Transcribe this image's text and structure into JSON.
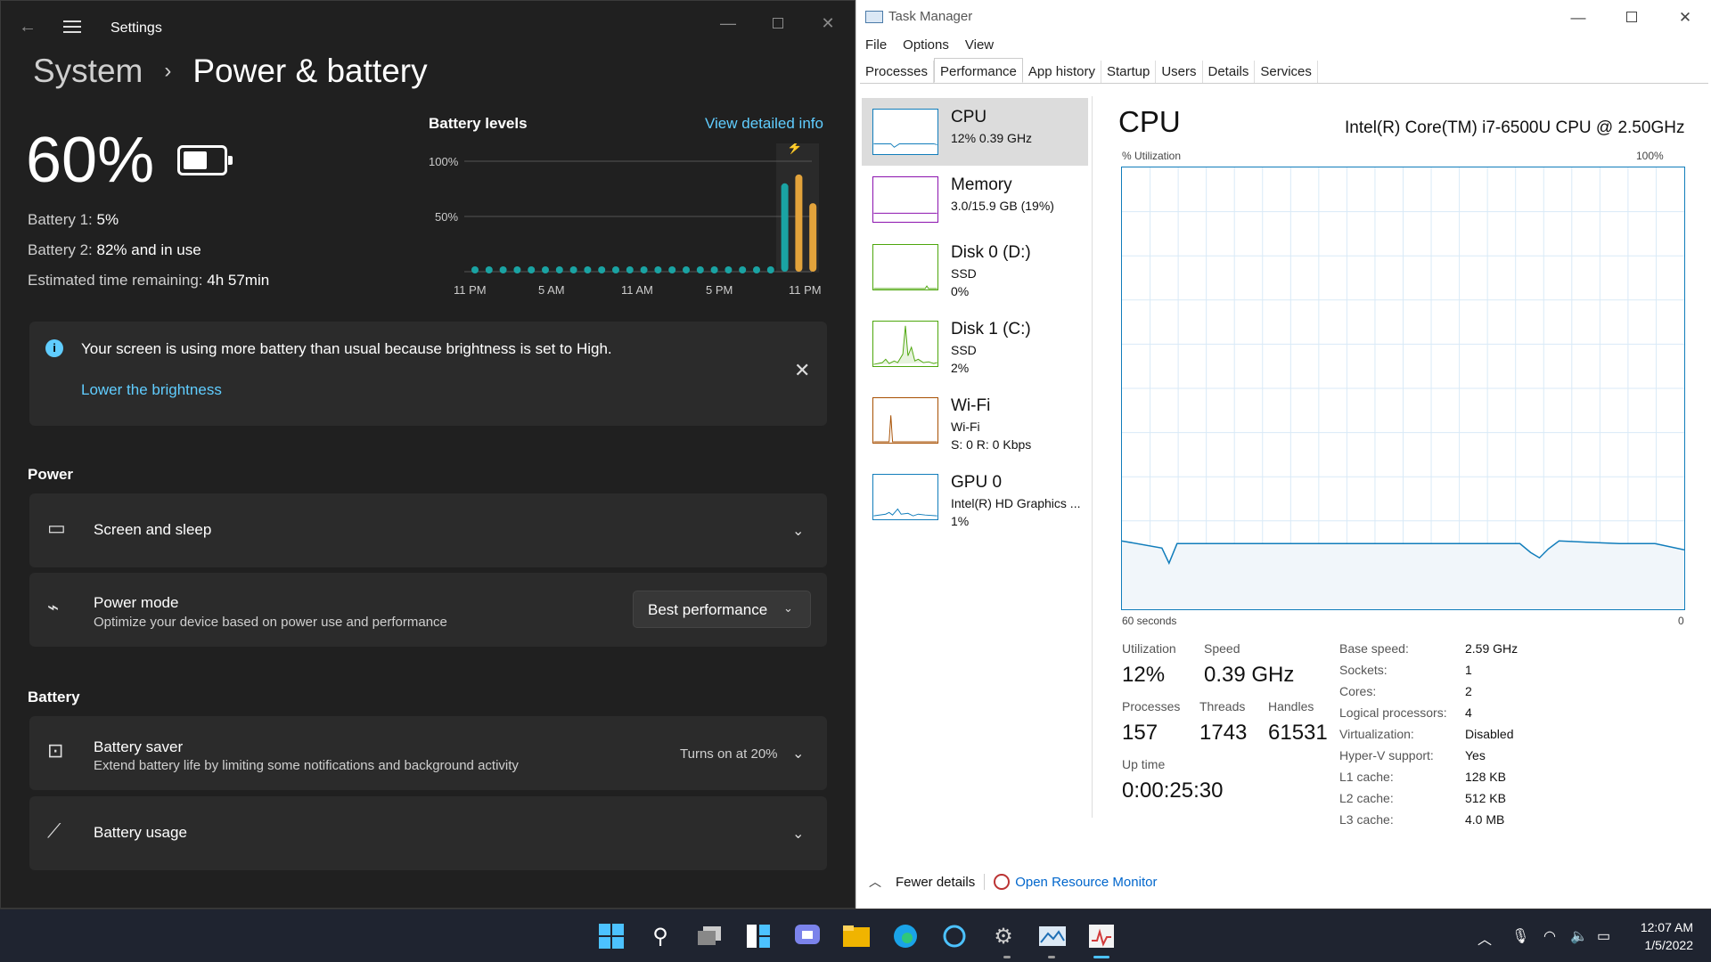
{
  "settings": {
    "app_title": "Settings",
    "breadcrumb": {
      "parent": "System",
      "separator": "›",
      "current": "Power & battery"
    },
    "battery_percent": "60%",
    "battery1_label": "Battery 1:",
    "battery1_value": "5%",
    "battery2_label": "Battery 2:",
    "battery2_value": "82% and in use",
    "time_label": "Estimated time remaining:",
    "time_value": "4h 57min",
    "levels_title": "Battery levels",
    "levels_link": "View detailed info",
    "chart": {
      "y_ticks": [
        "100%",
        "50%"
      ],
      "x_ticks": [
        "11 PM",
        "5 AM",
        "11 AM",
        "5 PM",
        "11 PM"
      ]
    },
    "info": {
      "text": "Your screen is using more battery than usual because brightness is set to High.",
      "link": "Lower the brightness"
    },
    "power_heading": "Power",
    "screen_sleep_label": "Screen and sleep",
    "power_mode_label": "Power mode",
    "power_mode_sub": "Optimize your device based on power use and performance",
    "power_mode_value": "Best performance",
    "battery_heading": "Battery",
    "saver_label": "Battery saver",
    "saver_sub": "Extend battery life by limiting some notifications and background activity",
    "saver_status": "Turns on at 20%",
    "usage_label": "Battery usage"
  },
  "chart_data": {
    "type": "bar",
    "title": "Battery levels",
    "categories": [
      "11 PM",
      "5 AM",
      "11 AM",
      "5 PM",
      "11 PM"
    ],
    "y_ticks": [
      "100%",
      "50%"
    ],
    "ylim": [
      0,
      100
    ],
    "series": [
      {
        "values": [
          1,
          1,
          1,
          1,
          1,
          1,
          1,
          1,
          1,
          1,
          1,
          1,
          1,
          1,
          1,
          1,
          1,
          1,
          1,
          1,
          1,
          1,
          80
        ]
      },
      {
        "values": [
          0,
          0,
          0,
          0,
          0,
          0,
          0,
          0,
          0,
          0,
          0,
          0,
          0,
          0,
          0,
          0,
          0,
          0,
          0,
          0,
          0,
          0,
          0,
          88,
          62
        ]
      }
    ]
  },
  "taskmanager": {
    "title": "Task Manager",
    "menu": [
      "File",
      "Options",
      "View"
    ],
    "tabs": [
      "Processes",
      "Performance",
      "App history",
      "Startup",
      "Users",
      "Details",
      "Services"
    ],
    "side": [
      {
        "name": "CPU",
        "l2": "12% 0.39 GHz",
        "l3": ""
      },
      {
        "name": "Memory",
        "l2": "3.0/15.9 GB (19%)",
        "l3": ""
      },
      {
        "name": "Disk 0 (D:)",
        "l2": "SSD",
        "l3": "0%"
      },
      {
        "name": "Disk 1 (C:)",
        "l2": "SSD",
        "l3": "2%"
      },
      {
        "name": "Wi-Fi",
        "l2": "Wi-Fi",
        "l3": "S: 0 R: 0 Kbps"
      },
      {
        "name": "GPU 0",
        "l2": "Intel(R) HD Graphics ...",
        "l3": "1%"
      }
    ],
    "heading": "CPU",
    "model": "Intel(R) Core(TM) i7-6500U CPU @ 2.50GHz",
    "util_label": "% Utilization",
    "util_max": "100%",
    "graph_left": "60 seconds",
    "graph_right": "0",
    "stats": {
      "utilization_label": "Utilization",
      "utilization": "12%",
      "speed_label": "Speed",
      "speed": "0.39 GHz",
      "processes_label": "Processes",
      "processes": "157",
      "threads_label": "Threads",
      "threads": "1743",
      "handles_label": "Handles",
      "handles": "61531",
      "uptime_label": "Up time",
      "uptime": "0:00:25:30"
    },
    "details": [
      {
        "k": "Base speed:",
        "v": "2.59 GHz"
      },
      {
        "k": "Sockets:",
        "v": "1"
      },
      {
        "k": "Cores:",
        "v": "2"
      },
      {
        "k": "Logical processors:",
        "v": "4"
      },
      {
        "k": "Virtualization:",
        "v": "Disabled"
      },
      {
        "k": "Hyper-V support:",
        "v": "Yes"
      },
      {
        "k": "L1 cache:",
        "v": "128 KB"
      },
      {
        "k": "L2 cache:",
        "v": "512 KB"
      },
      {
        "k": "L3 cache:",
        "v": "4.0 MB"
      }
    ],
    "footer_fewer": "Fewer details",
    "footer_link": "Open Resource Monitor"
  },
  "taskbar": {
    "time": "12:07 AM",
    "date": "1/5/2022",
    "icons": [
      "windows-start-icon",
      "search-icon",
      "task-view-icon",
      "widgets-icon",
      "chat-icon",
      "file-explorer-icon",
      "edge-icon",
      "cortana-icon",
      "settings-icon",
      "photos-icon",
      "task-manager-icon"
    ]
  },
  "colors": {
    "accent": "#60cdff",
    "cpu_graph": "#117dbb",
    "memory": "#8b12ae",
    "disk": "#4da60c",
    "wifi": "#a74f01",
    "battery_teal": "#1aa3a3",
    "battery_orange": "#e3a33b"
  }
}
